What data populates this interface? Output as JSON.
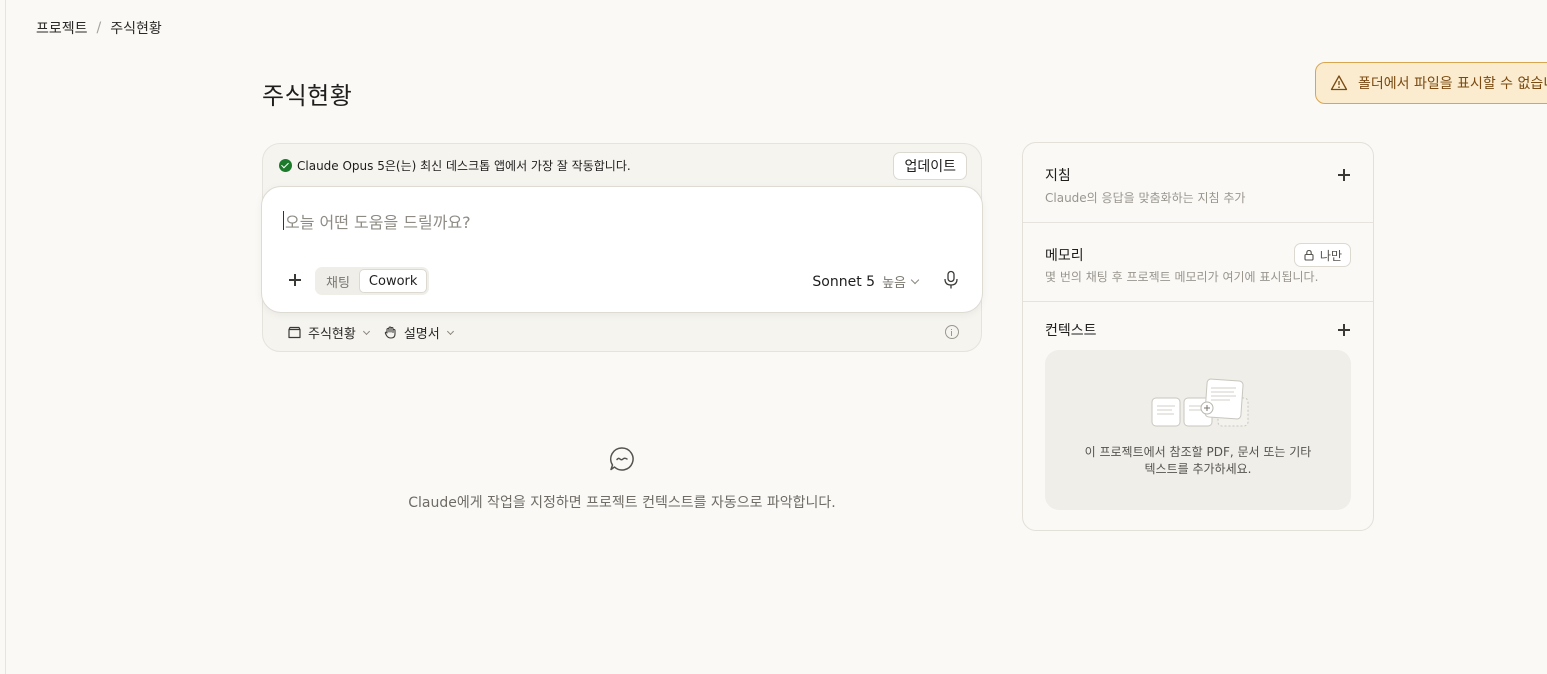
{
  "breadcrumb": {
    "parent": "프로젝트",
    "separator": "/",
    "current": "주식현황"
  },
  "page": {
    "title": "주식현황"
  },
  "toast": {
    "message": "폴더에서 파일을 표시할 수 없습니다",
    "icon": "warning-icon"
  },
  "composer": {
    "banner_text": "Claude Opus 5은(는) 최신 데스크톱 앱에서 가장 잘 작동합니다.",
    "update_label": "업데이트",
    "placeholder": "오늘 어떤 도움을 드릴까요?",
    "modes": [
      "채팅",
      "Cowork"
    ],
    "active_mode": "Cowork",
    "model_name": "Sonnet 5",
    "effort": "높음",
    "footer": {
      "folder_label": "주식현황",
      "style_label": "설명서"
    }
  },
  "empty_state": {
    "message": "Claude에게 작업을 지정하면 프로젝트 컨텍스트를 자동으로 파악합니다."
  },
  "side_panel": {
    "instructions": {
      "title": "지침",
      "subtitle": "Claude의 응답을 맞춤화하는 지침 추가"
    },
    "memory": {
      "title": "메모리",
      "subtitle": "몇 번의 채팅 후 프로젝트 메모리가 여기에 표시됩니다.",
      "badge": "나만"
    },
    "context": {
      "title": "컨텍스트",
      "line1": "이 프로젝트에서 참조할 PDF, 문서 또는 기타",
      "line2": "텍스트를 추가하세요."
    }
  },
  "colors": {
    "background": "#faf9f6",
    "toast_bg": "#fbeccf",
    "toast_border": "#d9a650",
    "success": "#1d7a2d"
  }
}
